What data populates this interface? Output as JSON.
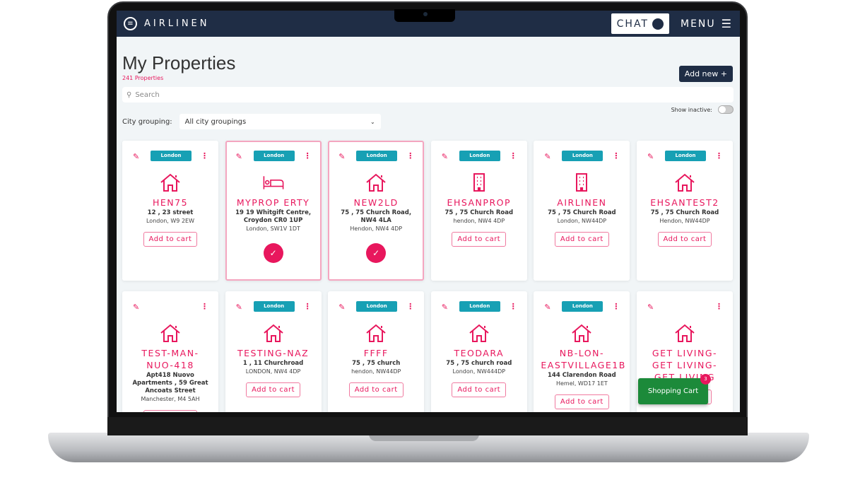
{
  "colors": {
    "accent": "#e8175d",
    "navy": "#1f2d45",
    "badge": "#17a0b4",
    "cart": "#1c8a3a"
  },
  "topbar": {
    "brand": "AIRLINEN",
    "chat": "CHAT",
    "menu": "MENU"
  },
  "page": {
    "title": "My Properties",
    "count": "241 Properties",
    "add_new": "Add new +",
    "search_placeholder": "Search",
    "show_inactive": "Show inactive:",
    "show_inactive_on": false,
    "city_label": "City grouping:",
    "city_value": "All city groupings"
  },
  "cards": [
    {
      "badge": "London",
      "icon": "house",
      "name": "HEN75",
      "addr": "12 , 23 street",
      "city": "London, W9 2EW",
      "selected": false
    },
    {
      "badge": "London",
      "icon": "bed",
      "name": "MYPROP ERTY",
      "addr": "19 19 Whitgift Centre, Croydon CR0 1UP",
      "city": "London, SW1V 1DT",
      "selected": true
    },
    {
      "badge": "London",
      "icon": "house",
      "name": "NEW2LD",
      "addr": "75 , 75 Church Road, NW4 4LA",
      "city": "Hendon, NW4 4DP",
      "selected": true
    },
    {
      "badge": "London",
      "icon": "building",
      "name": "EHSANPROP",
      "addr": "75 , 75 Church Road",
      "city": "hendon, NW4 4DP",
      "selected": false
    },
    {
      "badge": "London",
      "icon": "building",
      "name": "AIRLINEN",
      "addr": "75 , 75 Church Road",
      "city": "London, NW44DP",
      "selected": false
    },
    {
      "badge": "London",
      "icon": "house",
      "name": "EHSANTEST2",
      "addr": "75 , 75 Church Road",
      "city": "Hendon, NW44DP",
      "selected": false
    },
    {
      "badge": "",
      "icon": "house",
      "name": "TEST-MAN-NUO-418",
      "addr": "Apt418 Nuovo Apartments , 59 Great Ancoats Street",
      "city": "Manchester, M4 5AH",
      "selected": false
    },
    {
      "badge": "London",
      "icon": "house",
      "name": "TESTING-NAZ",
      "addr": "1 , 11 Churchroad",
      "city": "LONDON, NW4 4DP",
      "selected": false
    },
    {
      "badge": "London",
      "icon": "house",
      "name": "FFFF",
      "addr": "75 , 75 church",
      "city": "hendon, NW44DP",
      "selected": false
    },
    {
      "badge": "London",
      "icon": "house",
      "name": "TEODARA",
      "addr": "75 , 75 church road",
      "city": "London, NW444DP",
      "selected": false
    },
    {
      "badge": "London",
      "icon": "house",
      "name": "NB-LON-EASTVILLAGE1B",
      "addr": "144 Clarendon Road",
      "city": "Hemel, WD17 1ET",
      "selected": false
    },
    {
      "badge": "",
      "icon": "house",
      "name": "GET LIVING-GET LIVING-GET LIVING",
      "addr": "",
      "city": "",
      "selected": false
    }
  ],
  "add_to_cart": "Add to cart",
  "shopping_cart": {
    "label": "Shopping Cart",
    "count": "3"
  }
}
